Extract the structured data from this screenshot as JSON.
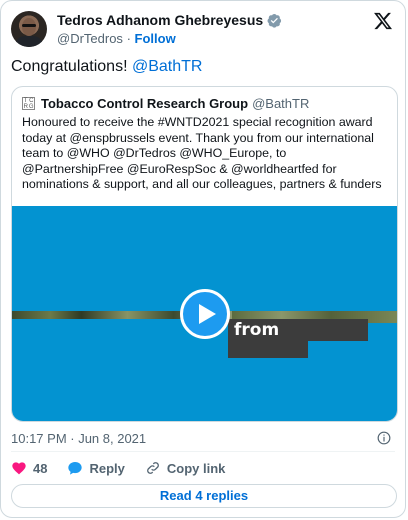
{
  "author": {
    "name": "Tedros Adhanom Ghebreyesus",
    "handle": "@DrTedros",
    "separator": "·",
    "follow_label": "Follow"
  },
  "tweet": {
    "text": "Congratulations!",
    "mention": "@BathTR"
  },
  "quoted": {
    "logo_letters": [
      "T",
      "C",
      "R",
      "G"
    ],
    "name": "Tobacco Control Research Group",
    "handle": "@BathTR",
    "text": "Honoured to receive the #WNTD2021 special recognition award today at @enspbrussels event. Thank you from our international team to @WHO @DrTedros @WHO_Europe, to @PartnershipFree @EuroRespSoc & @worldheartfed for nominations & support, and all our colleagues, partners & funders",
    "media": {
      "caption": "from",
      "background_color": "#0393d1",
      "play_icon": "play-icon"
    }
  },
  "meta": {
    "timestamp": "10:17 PM · Jun 8, 2021"
  },
  "actions": {
    "like_count": "48",
    "reply_label": "Reply",
    "copy_label": "Copy link"
  },
  "read_replies_label": "Read 4 replies",
  "colors": {
    "accent": "#006fd6",
    "like": "#f91880",
    "verified": "#1d9bf0"
  }
}
